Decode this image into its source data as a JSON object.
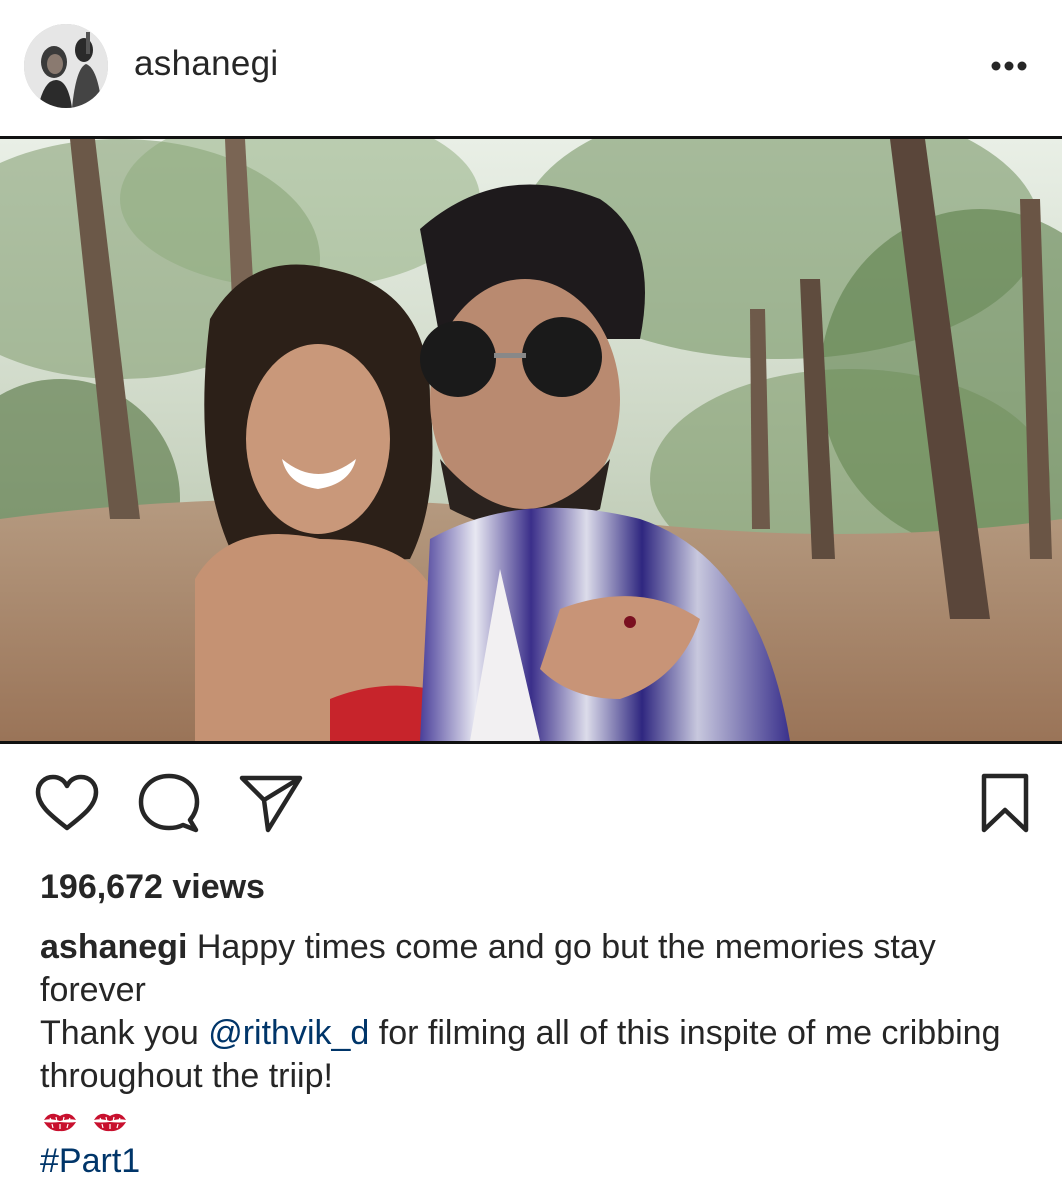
{
  "post": {
    "username": "ashanegi",
    "more_label": "•••",
    "views": "196,672 views",
    "caption": {
      "username": "ashanegi",
      "text_1": " Happy times come and go but the memories stay forever",
      "text_2_before": "Thank you ",
      "mention": "@rithvik_d",
      "text_2_after": " for filming all of this inspite of me cribbing throughout the triip!",
      "emojis": [
        "kiss-mark-icon",
        "kiss-mark-icon"
      ],
      "hashtag": "#Part1"
    },
    "icons": {
      "like": "heart-icon",
      "comment": "comment-icon",
      "share": "paper-plane-icon",
      "save": "bookmark-icon"
    }
  },
  "colors": {
    "text": "#262626",
    "link": "#003569",
    "emoji": "#c8102e"
  }
}
